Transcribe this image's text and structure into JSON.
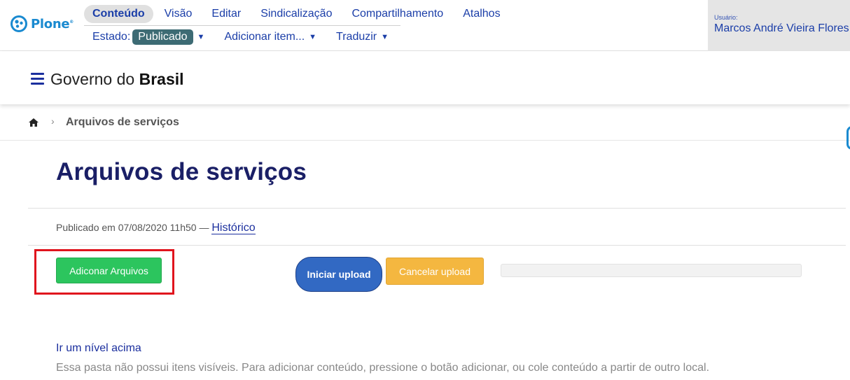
{
  "toolbar": {
    "logo_text": "Plone",
    "logo_reg": "®",
    "tabs": [
      {
        "label": "Conteúdo",
        "active": true
      },
      {
        "label": "Visão"
      },
      {
        "label": "Editar"
      },
      {
        "label": "Sindicalização"
      },
      {
        "label": "Compartilhamento"
      },
      {
        "label": "Atalhos"
      }
    ],
    "state_label": "Estado:",
    "state_value": "Publicado",
    "add_item": "Adicionar item...",
    "translate": "Traduzir",
    "caret": "▼",
    "user_label": "Usuário:",
    "user_name": "Marcos André Vieira Flores"
  },
  "header": {
    "title_regular": "Governo do",
    "title_bold": "Brasil"
  },
  "breadcrumb": {
    "separator": "›",
    "current": "Arquivos de serviços"
  },
  "main": {
    "title": "Arquivos de serviços",
    "byline_text": "Publicado em 07/08/2020 11h50 —",
    "history_link": "Histórico",
    "add_files_button": "Adiconar Arquivos",
    "start_upload_button": "Iniciar upload",
    "cancel_upload_button": "Cancelar upload",
    "upload_progress": 0,
    "up_level_link": "Ir um nível acima",
    "empty_message": "Essa pasta não possui itens visíveis. Para adicionar conteúdo, pressione o botão adicionar, ou cole conteúdo a partir de outro local."
  },
  "colors": {
    "accent_blue": "#1b3ea8",
    "add_button_green": "#2cc55e",
    "start_button_blue": "#3269c3",
    "cancel_button_orange": "#f4b740",
    "highlight_red": "#e0141d",
    "state_badge": "#3d6b74"
  }
}
